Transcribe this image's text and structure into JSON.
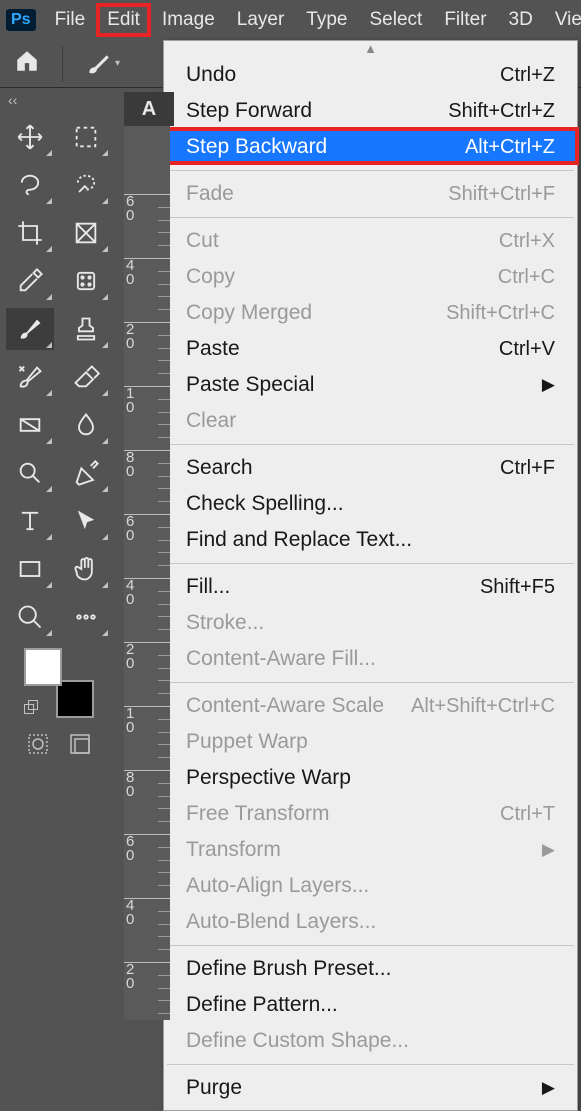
{
  "menubar": {
    "items": [
      {
        "label": "File"
      },
      {
        "label": "Edit",
        "highlight": true
      },
      {
        "label": "Image"
      },
      {
        "label": "Layer"
      },
      {
        "label": "Type"
      },
      {
        "label": "Select"
      },
      {
        "label": "Filter"
      },
      {
        "label": "3D"
      },
      {
        "label": "Vie"
      }
    ]
  },
  "doc_tab": {
    "label": "A"
  },
  "dropdown": {
    "groups": [
      [
        {
          "label": "Undo",
          "shortcut": "Ctrl+Z"
        },
        {
          "label": "Step Forward",
          "shortcut": "Shift+Ctrl+Z"
        },
        {
          "label": "Step Backward",
          "shortcut": "Alt+Ctrl+Z",
          "selected": true,
          "highlight": true
        }
      ],
      [
        {
          "label": "Fade",
          "shortcut": "Shift+Ctrl+F",
          "disabled": true
        }
      ],
      [
        {
          "label": "Cut",
          "shortcut": "Ctrl+X",
          "disabled": true
        },
        {
          "label": "Copy",
          "shortcut": "Ctrl+C",
          "disabled": true
        },
        {
          "label": "Copy Merged",
          "shortcut": "Shift+Ctrl+C",
          "disabled": true
        },
        {
          "label": "Paste",
          "shortcut": "Ctrl+V"
        },
        {
          "label": "Paste Special",
          "submenu": true
        },
        {
          "label": "Clear",
          "disabled": true
        }
      ],
      [
        {
          "label": "Search",
          "shortcut": "Ctrl+F"
        },
        {
          "label": "Check Spelling..."
        },
        {
          "label": "Find and Replace Text..."
        }
      ],
      [
        {
          "label": "Fill...",
          "shortcut": "Shift+F5"
        },
        {
          "label": "Stroke...",
          "disabled": true
        },
        {
          "label": "Content-Aware Fill...",
          "disabled": true
        }
      ],
      [
        {
          "label": "Content-Aware Scale",
          "shortcut": "Alt+Shift+Ctrl+C",
          "disabled": true
        },
        {
          "label": "Puppet Warp",
          "disabled": true
        },
        {
          "label": "Perspective Warp"
        },
        {
          "label": "Free Transform",
          "shortcut": "Ctrl+T",
          "disabled": true
        },
        {
          "label": "Transform",
          "submenu": true,
          "disabled": true
        },
        {
          "label": "Auto-Align Layers...",
          "disabled": true
        },
        {
          "label": "Auto-Blend Layers...",
          "disabled": true
        }
      ],
      [
        {
          "label": "Define Brush Preset..."
        },
        {
          "label": "Define Pattern..."
        },
        {
          "label": "Define Custom Shape...",
          "disabled": true
        }
      ],
      [
        {
          "label": "Purge",
          "submenu": true
        }
      ]
    ]
  },
  "ruler": {
    "labels": [
      "60",
      "40",
      "20",
      "0",
      "80",
      "60",
      "40",
      "20",
      "0",
      "80",
      "60",
      "40",
      "20"
    ],
    "leading": [
      "",
      "",
      "",
      "1 ",
      "",
      "",
      "",
      "",
      "1 ",
      "",
      "",
      "",
      ""
    ]
  },
  "tools": [
    {
      "name": "move-tool",
      "icon": "move"
    },
    {
      "name": "marquee-tool",
      "icon": "marquee"
    },
    {
      "name": "lasso-tool",
      "icon": "lasso"
    },
    {
      "name": "quick-select-tool",
      "icon": "quicksel"
    },
    {
      "name": "crop-tool",
      "icon": "crop"
    },
    {
      "name": "frame-tool",
      "icon": "frame"
    },
    {
      "name": "eyedropper-tool",
      "icon": "eyedrop"
    },
    {
      "name": "patch-tool",
      "icon": "patch"
    },
    {
      "name": "brush-tool",
      "icon": "brush",
      "active": true
    },
    {
      "name": "stamp-tool",
      "icon": "stamp"
    },
    {
      "name": "history-brush-tool",
      "icon": "histbrush"
    },
    {
      "name": "eraser-tool",
      "icon": "eraser"
    },
    {
      "name": "gradient-tool",
      "icon": "gradient"
    },
    {
      "name": "blur-tool",
      "icon": "drop"
    },
    {
      "name": "dodge-tool",
      "icon": "dodge"
    },
    {
      "name": "pen-tool",
      "icon": "pen"
    },
    {
      "name": "type-tool",
      "icon": "type"
    },
    {
      "name": "path-select-tool",
      "icon": "pathsel"
    },
    {
      "name": "rectangle-tool",
      "icon": "rect"
    },
    {
      "name": "hand-tool",
      "icon": "hand"
    },
    {
      "name": "zoom-tool",
      "icon": "zoom"
    },
    {
      "name": "more-tool",
      "icon": "more"
    }
  ]
}
